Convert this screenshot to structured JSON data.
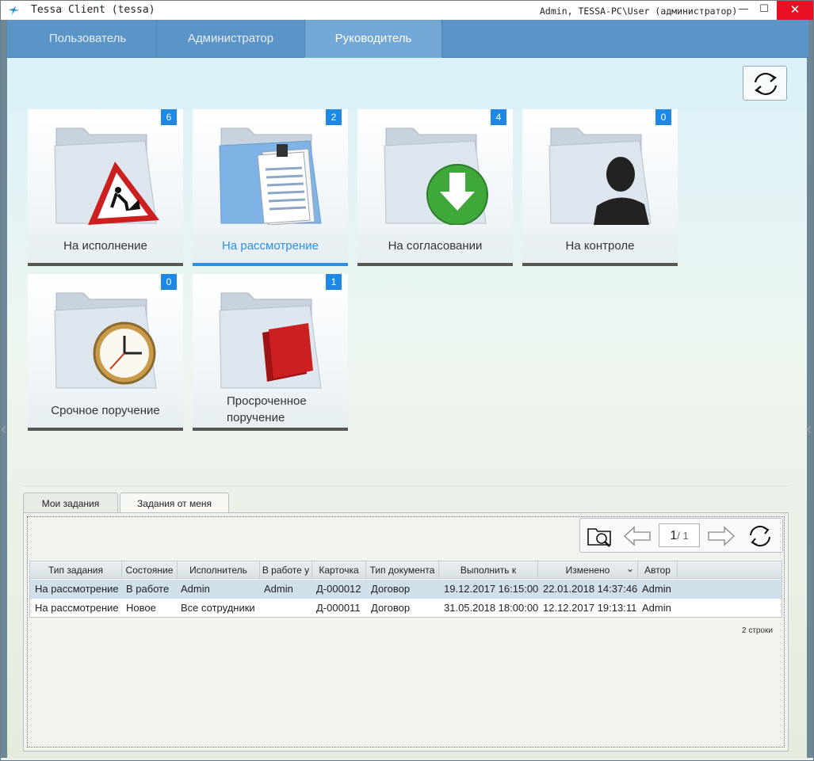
{
  "window": {
    "title": "Tessa Client (tessa)",
    "user": "Admin, TESSA-PC\\User (администратор)",
    "minimize": "—",
    "maximize": "☐",
    "close": "✕"
  },
  "nav": {
    "tabs": [
      {
        "label": "Пользователь"
      },
      {
        "label": "Администратор"
      },
      {
        "label": "Руководитель"
      }
    ],
    "active": 2
  },
  "tiles": [
    {
      "label": "На исполнение",
      "count": "6",
      "icon": "warning-sign-icon"
    },
    {
      "label": "На рассмотрение",
      "count": "2",
      "icon": "document-icon"
    },
    {
      "label": "На согласовании",
      "count": "4",
      "icon": "green-download-arrow-icon"
    },
    {
      "label": "На контроле",
      "count": "0",
      "icon": "person-silhouette-icon"
    },
    {
      "label": "Срочное поручение",
      "count": "0",
      "icon": "clock-icon"
    },
    {
      "label": "Просроченное поручение",
      "label_line1": "Просроченное",
      "label_line2": "поручение",
      "count": "1",
      "icon": "red-books-icon"
    }
  ],
  "bottom_tabs": [
    {
      "label": "Мои задания"
    },
    {
      "label": "Задания от меня"
    }
  ],
  "pager": {
    "current": "1",
    "total": "/ 1"
  },
  "table": {
    "columns": [
      "Тип задания",
      "Состояние",
      "Исполнитель",
      "В работе у",
      "Карточка",
      "Тип документа",
      "Выполнить к",
      "Изменено",
      "Автор"
    ],
    "rows": [
      [
        "На рассмотрение",
        "В работе",
        "Admin",
        "Admin",
        "Д-000012",
        "Договор",
        "19.12.2017 16:15:00",
        "22.01.2018 14:37:46",
        "Admin"
      ],
      [
        "На рассмотрение",
        "Новое",
        "Все сотрудники",
        "",
        "Д-000011",
        "Договор",
        "31.05.2018 18:00:00",
        "12.12.2017 19:13:11",
        "Admin"
      ]
    ],
    "sort_indicator": "⌄",
    "row_count": "2 строки"
  },
  "colors": {
    "accent": "#2d8fe6",
    "nav": "#5b95c8",
    "badge": "#1e88e5"
  }
}
